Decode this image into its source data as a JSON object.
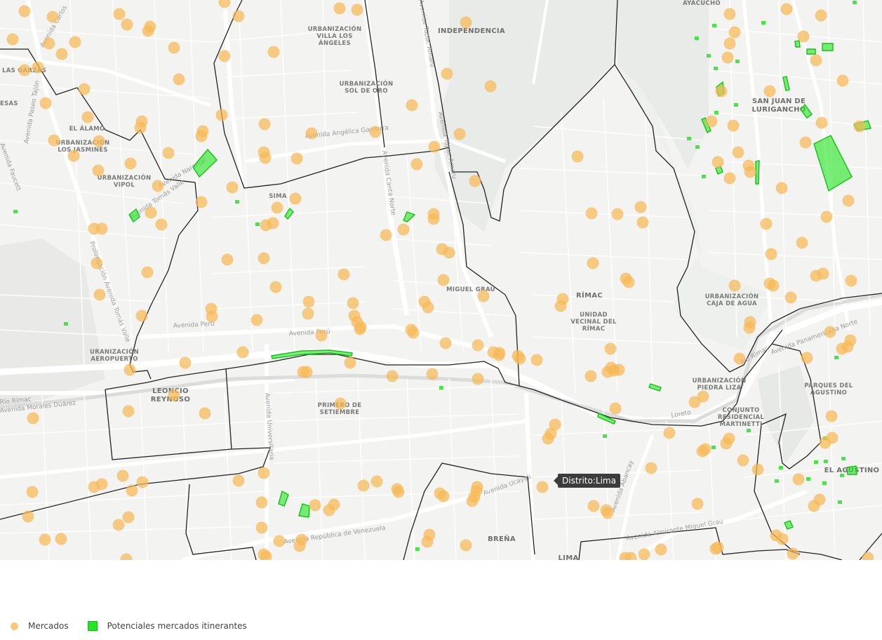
{
  "colors": {
    "markets": "#f7b955",
    "itinerant": "#22e622",
    "boundary": "#222222"
  },
  "labels": {
    "independencia": "INDEPENDENCIA",
    "villa_angeles": [
      "URBANIZACIÓN",
      "VILLA LOS",
      "ÁNGELES"
    ],
    "sol_oro": [
      "URBANIZACIÓN",
      "SOL DE ORO"
    ],
    "san_juan": [
      "SAN JUAN DE",
      "LURIGANCHO"
    ],
    "ayacucho": "AYACUCHO",
    "las_garzas": "LAS GARZAS",
    "el_alamo": "EL ÁLAMO",
    "jasmines": [
      "URBANIZACIÓN",
      "LOS JASMINES"
    ],
    "vipol": [
      "URBANIZACIÓN",
      "VIPOL"
    ],
    "sima": "SIMA",
    "miguel_grau": "MIGUEL GRAU",
    "rimac": "RÍMAC",
    "unidad_vecinal": [
      "UNIDAD",
      "VECINAL DEL",
      "RÍMAC"
    ],
    "caja_agua": [
      "URBANIZACIÓN",
      "CAJA DE AGUA"
    ],
    "aeropuerto": [
      "URANIZACIÓN",
      "AEROPUERTO"
    ],
    "leoncio": [
      "LEONCIO",
      "REYNOSO"
    ],
    "primero": [
      "PRIMERO DE",
      "SETIEMBRE"
    ],
    "piedra_liza": [
      "URBANIZACIÓN",
      "PIEDRA LIZA"
    ],
    "parques": [
      "PARQUES DEL",
      "AGUSTINO"
    ],
    "martinetti": [
      "CONJUNTO",
      "RESIDENCIAL",
      "MARTINETTI"
    ],
    "el_agustino": "EL AGUSTINO",
    "brena": "BREÑA",
    "lima": "LIMA",
    "esas": "ESAS"
  },
  "streets": {
    "gamarra": "Avenida Angélica Gamarra",
    "peru": "Avenida Perú",
    "peru2": "Avenida Perú",
    "tomas_valle": "Avenida Tomás Valle",
    "paseo_tajon": "Avenida Paseo Tajón",
    "carlos": "Avenida Carlos",
    "tupac": "Avenida Túpac Amaru",
    "tupac2": "Avenida Túpac Amaru",
    "pan_norte": "Avenida Panamericana Norte",
    "venezuela": "Avenida República de Venezuela",
    "universitaria": "Avenida Universitaria",
    "abancay": "Avenida Abancay",
    "grau": "Avenida Almirante Miguel Grau",
    "loreto": "Loreto",
    "canta_norte": "Avenida Canta Norte",
    "faucett": "Avenida Faucett",
    "prolongacion": "Prolongación Avenida Tomás Valle",
    "rio_rimac": "Río Rímac",
    "rio_rimac2": "Río Rímac",
    "morales_duarez": "Avenida Morales Duárez",
    "naranjal": "Avenida Naranjal",
    "ucayali": "Avenida Ucayali"
  },
  "tooltip": "Distrito:Lima",
  "legend": {
    "markets_label": "Mercados",
    "itinerant_label": "Potenciales mercados itinerantes"
  }
}
